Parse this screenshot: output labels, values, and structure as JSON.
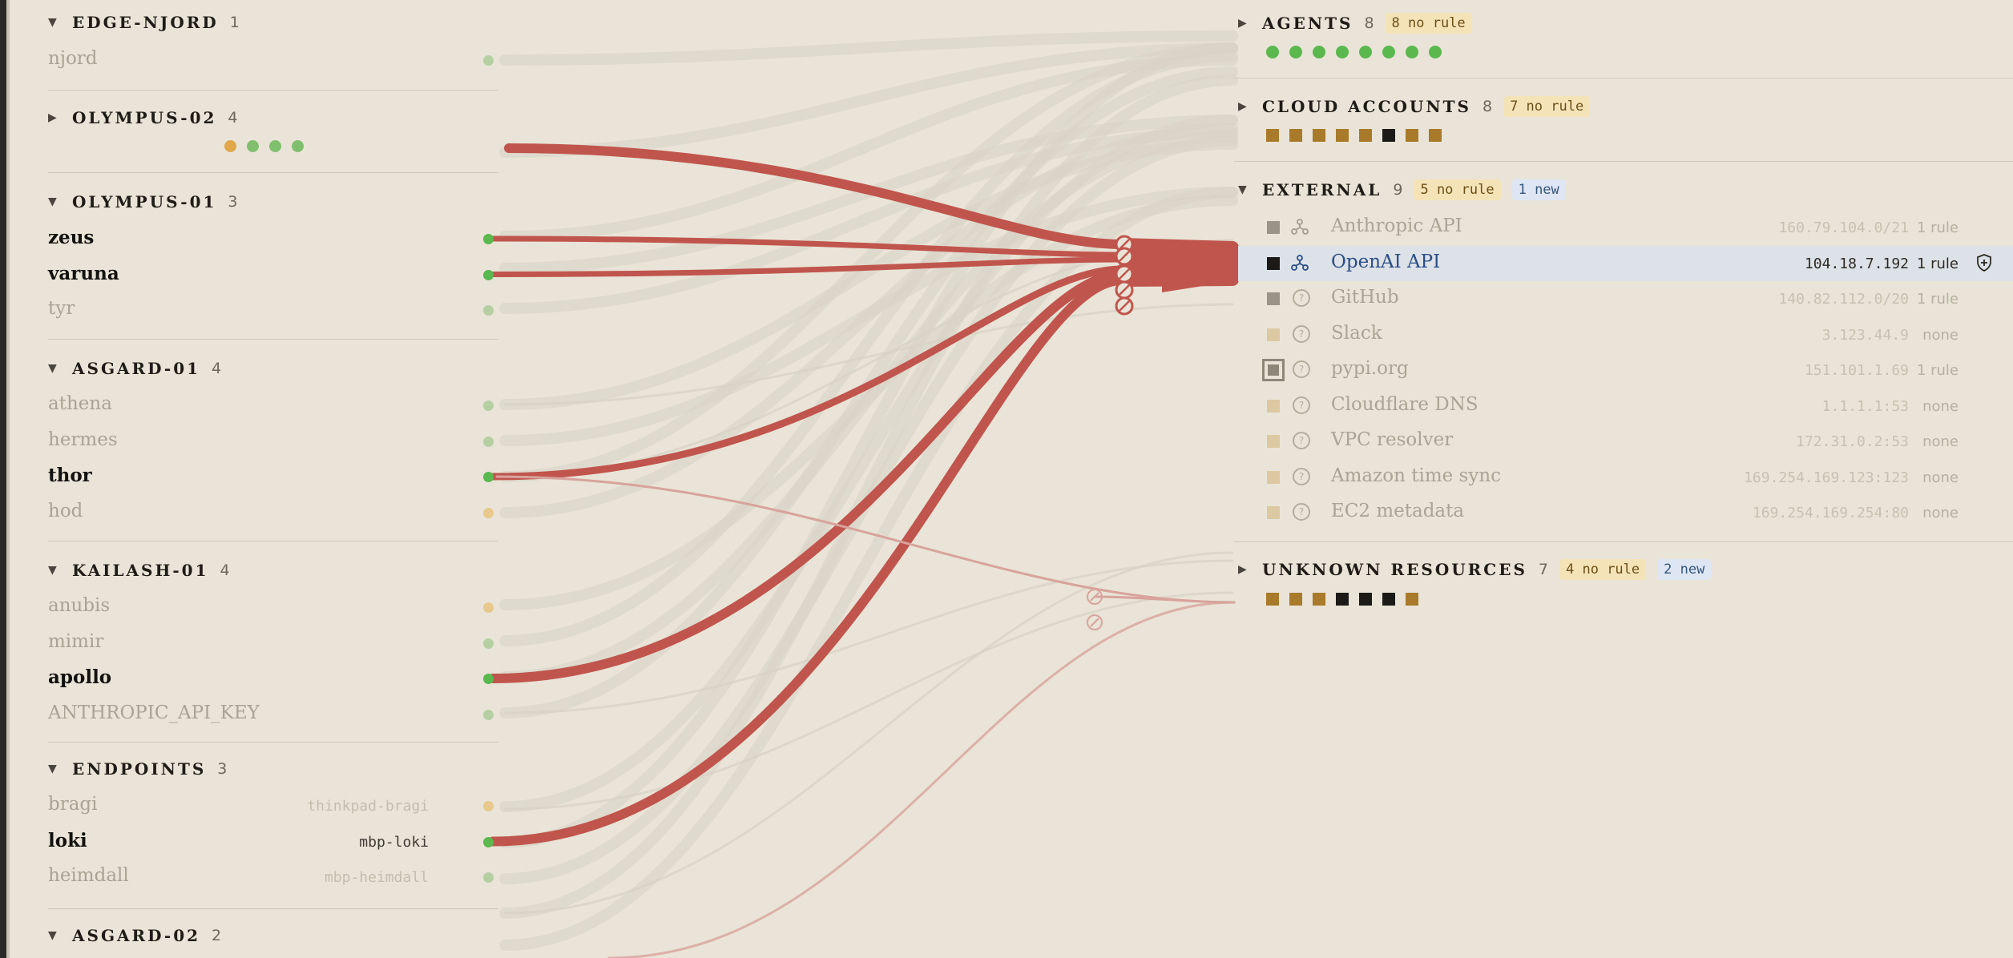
{
  "left_groups": [
    {
      "id": "edge-njord",
      "name": "EDGE-NJORD",
      "count": "1",
      "expanded": true,
      "rows": [
        {
          "name": "njord",
          "host": "",
          "active": false,
          "dot": "#b5cfa2"
        }
      ]
    },
    {
      "id": "olympus-02",
      "name": "OLYMPUS-02",
      "count": "4",
      "expanded": false,
      "dots": [
        "#e0a84a",
        "#7fbf6e",
        "#7fbf6e",
        "#7fbf6e"
      ]
    },
    {
      "id": "olympus-01",
      "name": "OLYMPUS-01",
      "count": "3",
      "expanded": true,
      "rows": [
        {
          "name": "zeus",
          "host": "",
          "active": true,
          "dot": "#5ab84e"
        },
        {
          "name": "varuna",
          "host": "",
          "active": true,
          "dot": "#5ab84e"
        },
        {
          "name": "tyr",
          "host": "",
          "active": false,
          "dot": "#b5cfa2"
        }
      ]
    },
    {
      "id": "asgard-01",
      "name": "ASGARD-01",
      "count": "4",
      "expanded": true,
      "rows": [
        {
          "name": "athena",
          "host": "",
          "active": false,
          "dot": "#b5cfa2"
        },
        {
          "name": "hermes",
          "host": "",
          "active": false,
          "dot": "#b5cfa2"
        },
        {
          "name": "thor",
          "host": "",
          "active": true,
          "dot": "#5ab84e"
        },
        {
          "name": "hod",
          "host": "",
          "active": false,
          "dot": "#e8c88c"
        }
      ]
    },
    {
      "id": "kailash-01",
      "name": "KAILASH-01",
      "count": "4",
      "expanded": true,
      "rows": [
        {
          "name": "anubis",
          "host": "",
          "active": false,
          "dot": "#e8c88c"
        },
        {
          "name": "mimir",
          "host": "",
          "active": false,
          "dot": "#b5cfa2"
        },
        {
          "name": "apollo",
          "host": "",
          "active": true,
          "dot": "#5ab84e"
        },
        {
          "name": "ANTHROPIC_API_KEY",
          "host": "",
          "active": false,
          "dot": "#b5cfa2"
        }
      ]
    },
    {
      "id": "endpoints",
      "name": "ENDPOINTS",
      "count": "3",
      "expanded": true,
      "rows": [
        {
          "name": "bragi",
          "host": "thinkpad-bragi",
          "active": false,
          "dot": "#e8c88c"
        },
        {
          "name": "loki",
          "host": "mbp-loki",
          "active": true,
          "dot": "#5ab84e"
        },
        {
          "name": "heimdall",
          "host": "mbp-heimdall",
          "active": false,
          "dot": "#b5cfa2"
        }
      ]
    },
    {
      "id": "asgard-02",
      "name": "ASGARD-02",
      "count": "2",
      "expanded": true,
      "rows": []
    }
  ],
  "right_groups": {
    "agents": {
      "name": "AGENTS",
      "count": "8",
      "no_rule": "8 no rule",
      "new": "",
      "expanded": false,
      "swatches": [
        "#5ab84e",
        "#5ab84e",
        "#5ab84e",
        "#5ab84e",
        "#5ab84e",
        "#5ab84e",
        "#5ab84e",
        "#5ab84e"
      ]
    },
    "cloud": {
      "name": "CLOUD ACCOUNTS",
      "count": "8",
      "no_rule": "7 no rule",
      "new": "",
      "expanded": false,
      "swatches": [
        "#a87a2a",
        "#a87a2a",
        "#a87a2a",
        "#a87a2a",
        "#a87a2a",
        "#1b1a17",
        "#a87a2a",
        "#a87a2a"
      ]
    },
    "external": {
      "name": "EXTERNAL",
      "count": "9",
      "no_rule": "5 no rule",
      "new": "1 new",
      "expanded": true,
      "rows": [
        {
          "name": "Anthropic API",
          "addr": "160.79.104.0/21",
          "rule": "1 rule",
          "sq": "#9a9488",
          "icon": "network",
          "selected": false,
          "framed": false
        },
        {
          "name": "OpenAI API",
          "addr": "104.18.7.192",
          "rule": "1 rule",
          "sq": "#1b1a17",
          "icon": "network",
          "selected": true,
          "framed": false
        },
        {
          "name": "GitHub",
          "addr": "140.82.112.0/20",
          "rule": "1 rule",
          "sq": "#9a9488",
          "icon": "question",
          "selected": false,
          "framed": false
        },
        {
          "name": "Slack",
          "addr": "3.123.44.9",
          "rule": "none",
          "sq": "#dcc9a2",
          "icon": "question",
          "selected": false,
          "framed": false
        },
        {
          "name": "pypi.org",
          "addr": "151.101.1.69",
          "rule": "1 rule",
          "sq": "#8d8779",
          "icon": "question",
          "selected": false,
          "framed": true
        },
        {
          "name": "Cloudflare DNS",
          "addr": "1.1.1.1:53",
          "rule": "none",
          "sq": "#dcc9a2",
          "icon": "question",
          "selected": false,
          "framed": false
        },
        {
          "name": "VPC resolver",
          "addr": "172.31.0.2:53",
          "rule": "none",
          "sq": "#dcc9a2",
          "icon": "question",
          "selected": false,
          "framed": false
        },
        {
          "name": "Amazon time sync",
          "addr": "169.254.169.123:123",
          "rule": "none",
          "sq": "#dcc9a2",
          "icon": "question",
          "selected": false,
          "framed": false
        },
        {
          "name": "EC2 metadata",
          "addr": "169.254.169.254:80",
          "rule": "none",
          "sq": "#dcc9a2",
          "icon": "question",
          "selected": false,
          "framed": false
        }
      ]
    },
    "unknown": {
      "name": "UNKNOWN RESOURCES",
      "count": "7",
      "no_rule": "4 no rule",
      "new": "2 new",
      "expanded": false,
      "swatches": [
        "#a87a2a",
        "#a87a2a",
        "#a87a2a",
        "#1b1a17",
        "#1b1a17",
        "#1b1a17",
        "#a87a2a"
      ]
    }
  },
  "colors": {
    "active_flow": "#c0554d",
    "faint_flow": "#d8a39c",
    "ghost_flow": "#d7d2c6",
    "accent_blue": "#2a4d86"
  }
}
